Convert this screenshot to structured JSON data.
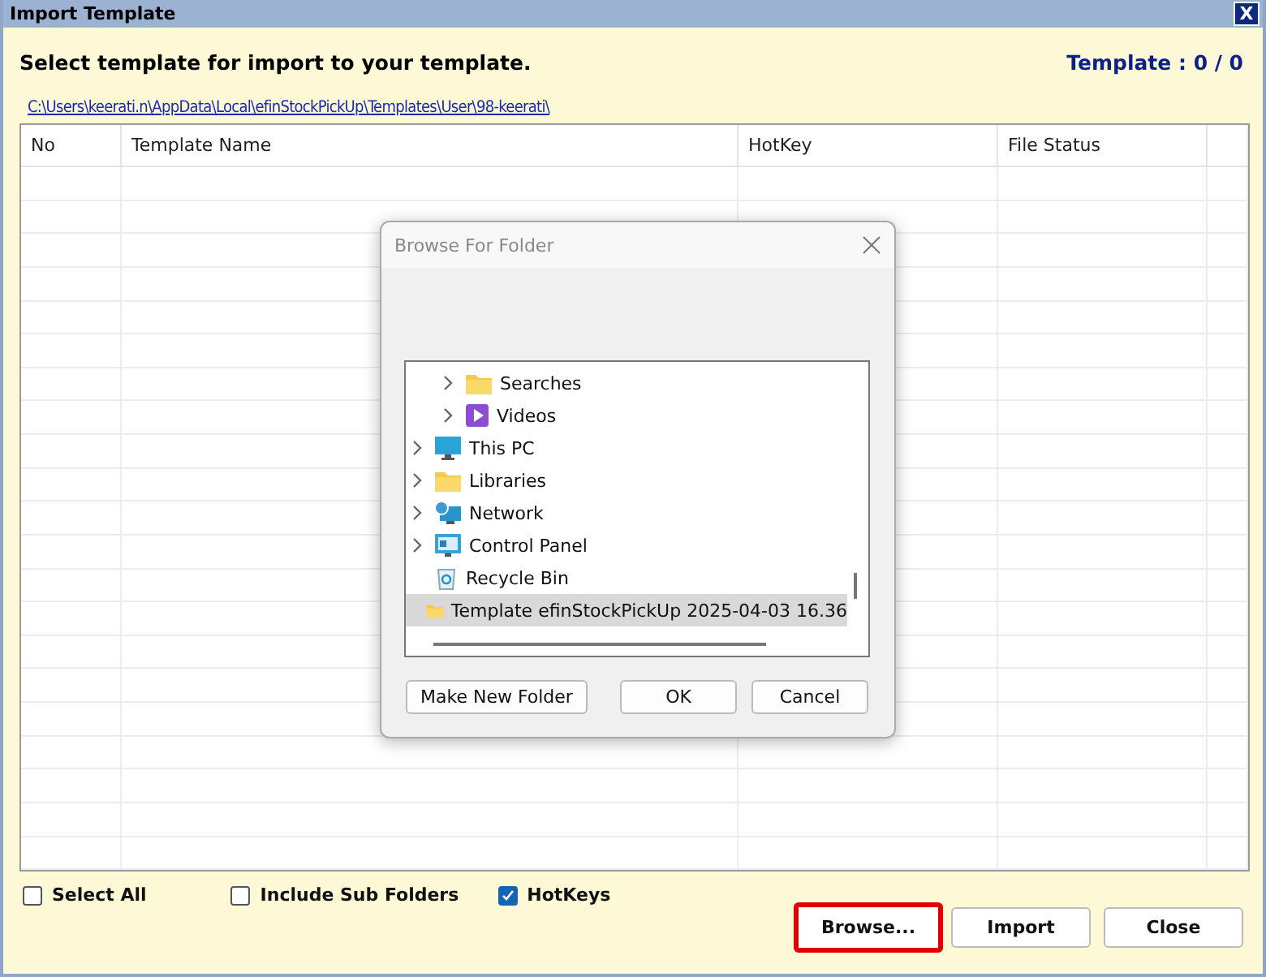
{
  "window": {
    "title": "Import Template",
    "close_glyph": "X"
  },
  "heading": "Select template for import to your template.",
  "counter": "Template : 0 / 0",
  "path_link": "C:\\Users\\keerati.n\\AppData\\Local\\efinStockPickUp\\Templates\\User\\98-keerati\\",
  "table": {
    "columns": [
      "No",
      "Template Name",
      "HotKey",
      "File Status"
    ]
  },
  "dialog": {
    "title": "Browse For Folder",
    "tree": {
      "scrolled_branch": [
        {
          "label": "Searches",
          "kind": "folder",
          "expandable": true,
          "selected": false
        },
        {
          "label": "Videos",
          "kind": "video",
          "expandable": true,
          "selected": false
        }
      ],
      "items": [
        {
          "label": "This PC",
          "kind": "pc",
          "expandable": true,
          "selected": false
        },
        {
          "label": "Libraries",
          "kind": "folder",
          "expandable": true,
          "selected": false
        },
        {
          "label": "Network",
          "kind": "network",
          "expandable": true,
          "selected": false
        },
        {
          "label": "Control Panel",
          "kind": "control",
          "expandable": true,
          "selected": false
        },
        {
          "label": "Recycle Bin",
          "kind": "recycle",
          "expandable": false,
          "selected": false
        },
        {
          "label": "Template efinStockPickUp 2025-04-03 16.36",
          "kind": "folder",
          "expandable": false,
          "selected": true
        }
      ]
    },
    "buttons": [
      {
        "label": "Make New Folder",
        "kind": "left"
      },
      {
        "label": "OK",
        "kind": "right"
      },
      {
        "label": "Cancel",
        "kind": "right"
      }
    ]
  },
  "options": [
    {
      "label": "Select All",
      "checked": false
    },
    {
      "label": "Include Sub Folders",
      "checked": false
    },
    {
      "label": "HotKeys",
      "checked": true
    }
  ],
  "buttons": [
    {
      "label": "Browse...",
      "highlighted": true
    },
    {
      "label": "Import",
      "highlighted": false
    },
    {
      "label": "Close",
      "highlighted": false
    }
  ]
}
